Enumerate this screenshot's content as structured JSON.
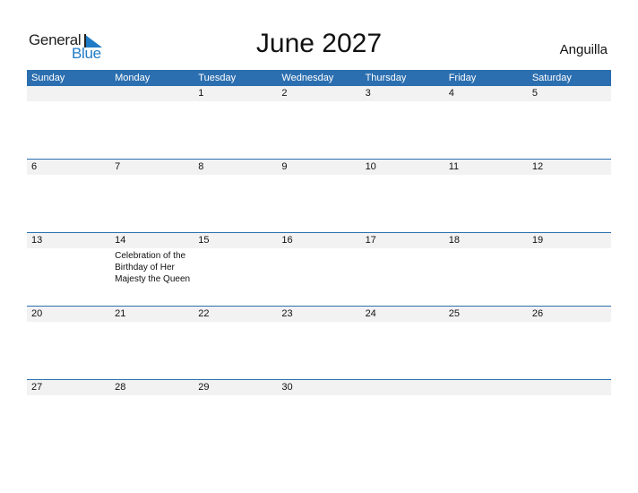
{
  "logo": {
    "part1": "General",
    "part2": "Blue"
  },
  "title": "June 2027",
  "country": "Anguilla",
  "weekdays": [
    "Sunday",
    "Monday",
    "Tuesday",
    "Wednesday",
    "Thursday",
    "Friday",
    "Saturday"
  ],
  "weeks": [
    {
      "days": [
        "",
        "",
        "1",
        "2",
        "3",
        "4",
        "5"
      ],
      "events": [
        "",
        "",
        "",
        "",
        "",
        "",
        ""
      ]
    },
    {
      "days": [
        "6",
        "7",
        "8",
        "9",
        "10",
        "11",
        "12"
      ],
      "events": [
        "",
        "",
        "",
        "",
        "",
        "",
        ""
      ]
    },
    {
      "days": [
        "13",
        "14",
        "15",
        "16",
        "17",
        "18",
        "19"
      ],
      "events": [
        "",
        "Celebration of the\nBirthday of Her\nMajesty the Queen",
        "",
        "",
        "",
        "",
        ""
      ]
    },
    {
      "days": [
        "20",
        "21",
        "22",
        "23",
        "24",
        "25",
        "26"
      ],
      "events": [
        "",
        "",
        "",
        "",
        "",
        "",
        ""
      ]
    },
    {
      "days": [
        "27",
        "28",
        "29",
        "30",
        "",
        "",
        ""
      ],
      "events": [
        "",
        "",
        "",
        "",
        "",
        "",
        ""
      ]
    }
  ],
  "colors": {
    "header": "#2c6fb0",
    "brand_blue": "#1f7bc6",
    "strip": "#f2f2f2"
  }
}
